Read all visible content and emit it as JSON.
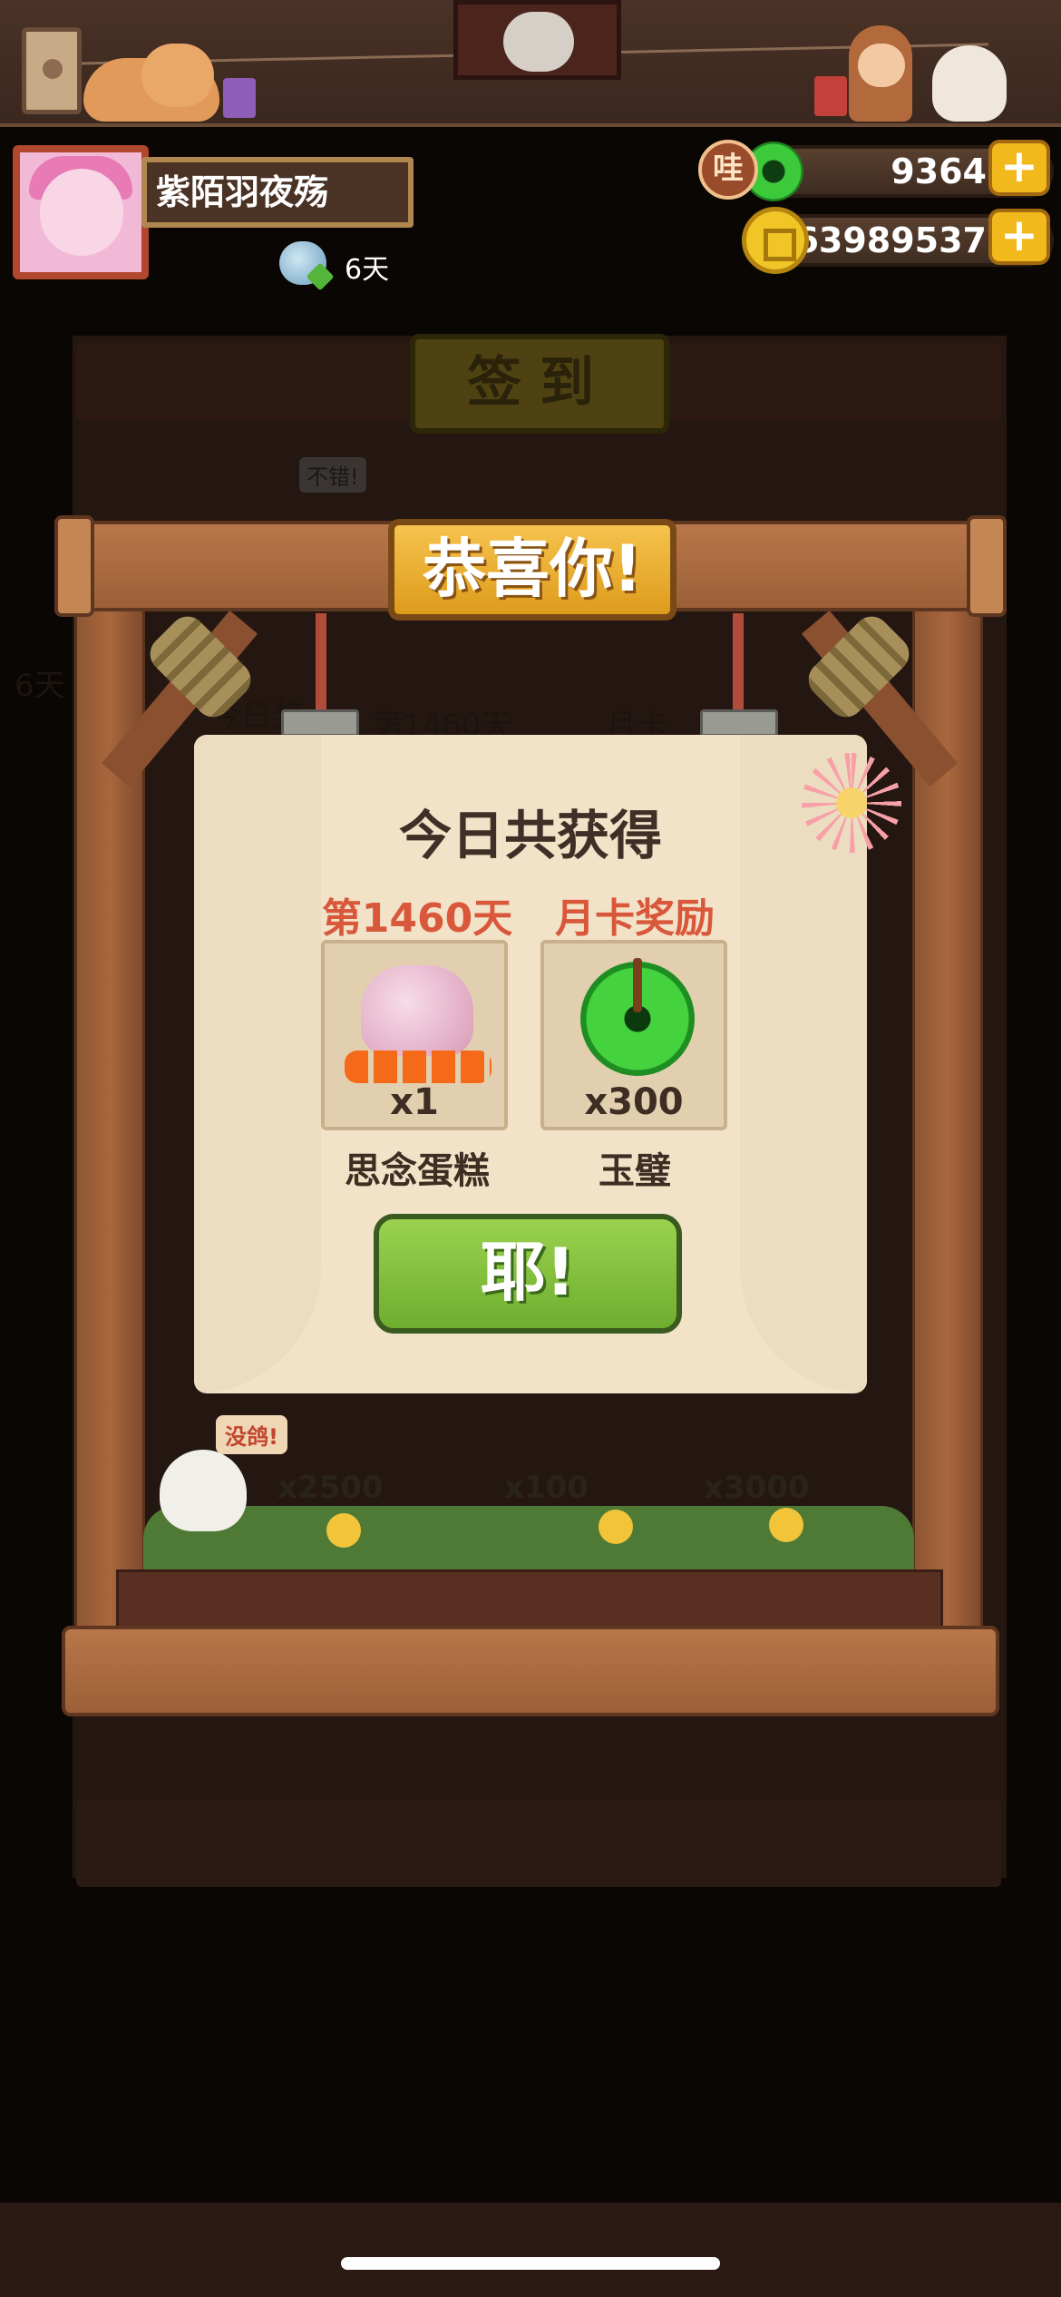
{
  "player": {
    "name": "紫陌羽夜殇",
    "streak_days": "6天"
  },
  "currency": {
    "jade_badge": "哇",
    "jade_amount": "9364",
    "coin_amount": "63989537",
    "plus_label": "+"
  },
  "background": {
    "sign_in_title": "签到",
    "bubble_1": "不错!",
    "bird_bubble": "没鸽!",
    "reward_1": "x2500",
    "reward_2": "x100",
    "reward_3": "x3000",
    "day_label": "第1460天",
    "today_label": "今日奖",
    "month_card": "月卡",
    "day_count": "6天"
  },
  "popup": {
    "banner_title": "恭喜你!",
    "card_title": "今日共获得",
    "rewards": [
      {
        "header": "第1460天",
        "count": "x1",
        "name": "思念蛋糕",
        "icon": "cake-icon"
      },
      {
        "header": "月卡奖励",
        "count": "x300",
        "name": "玉璧",
        "icon": "jade-icon"
      }
    ],
    "confirm_label": "耶!"
  },
  "colors": {
    "accent_orange": "#d9573a",
    "button_green": "#7fbf3a",
    "gold": "#f2b91d",
    "wood": "#a9673d"
  }
}
